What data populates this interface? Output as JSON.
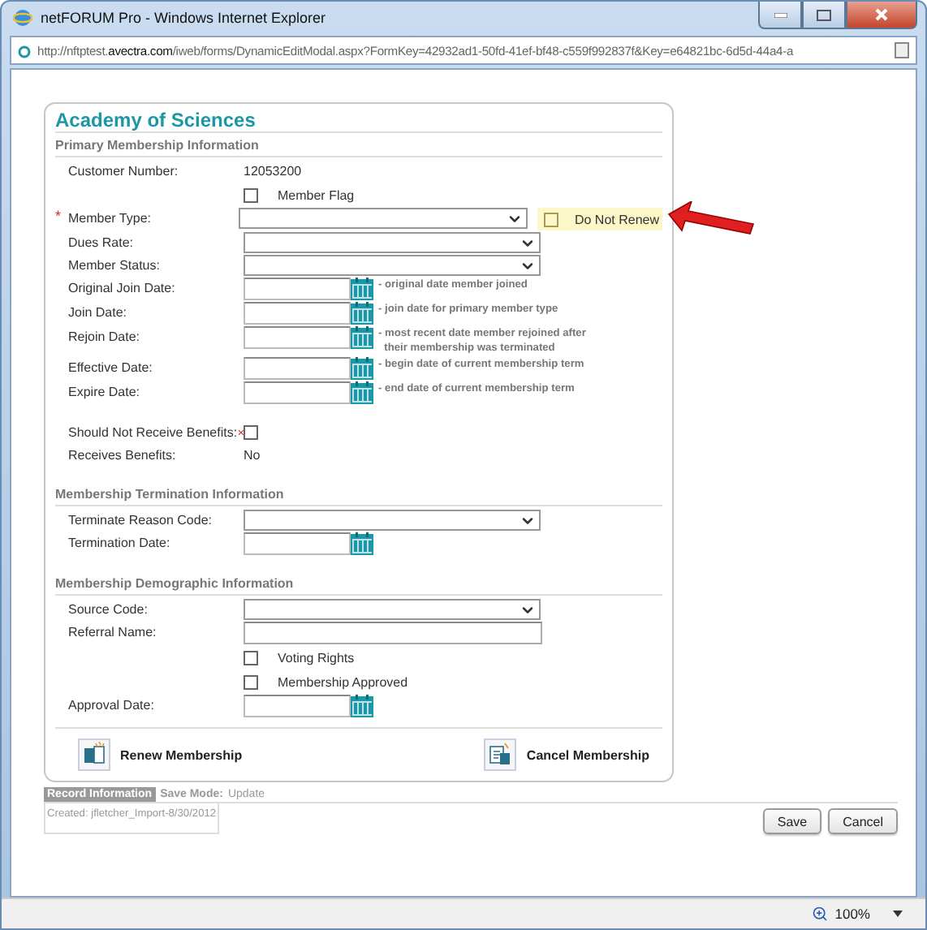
{
  "window": {
    "title": "netFORUM Pro - Windows Internet Explorer",
    "url": "http://nftptest.**avectra.com**/iweb/forms/DynamicEditModal.aspx?FormKey=42932ad1-50fd-41ef-bf48-c559f992837f&Key=e64821bc-6d5d-44a4-a"
  },
  "form": {
    "title": "Academy of Sciences",
    "sections": [
      {
        "heading": "Primary Membership Information",
        "rows": [
          {
            "kind": "text",
            "label": "Customer Number:",
            "value": "12053200"
          },
          {
            "kind": "checkbox",
            "label": "Member Flag",
            "checked": false
          },
          {
            "kind": "select",
            "label": "Member Type:",
            "required_mark": "*",
            "flag": {
              "label": "Do Not Renew",
              "checked": false
            }
          },
          {
            "kind": "select",
            "label": "Dues Rate:"
          },
          {
            "kind": "select",
            "label": "Member Status:"
          },
          {
            "kind": "date",
            "label": "Original Join Date:",
            "hint": "- original date member joined"
          },
          {
            "kind": "date",
            "label": "Join Date:",
            "hint": "- join date for primary member type"
          },
          {
            "kind": "date",
            "label": "Rejoin Date:",
            "hint": "- most recent date member rejoined after\n  their membership was terminated"
          },
          {
            "kind": "date",
            "label": "Effective Date:",
            "hint": "- begin date of current membership term"
          },
          {
            "kind": "date",
            "label": "Expire Date:",
            "hint": "- end date of current membership term"
          },
          {
            "kind": "labeled_checkbox",
            "label": "Should Not Receive Benefits:",
            "checked": false
          },
          {
            "kind": "text",
            "label": "Receives Benefits:",
            "value": "No"
          }
        ]
      },
      {
        "heading": "Membership Termination Information",
        "rows": [
          {
            "kind": "select",
            "label": "Terminate Reason Code:"
          },
          {
            "kind": "date",
            "label": "Termination Date:"
          }
        ]
      },
      {
        "heading": "Membership Demographic Information",
        "rows": [
          {
            "kind": "select",
            "label": "Source Code:"
          },
          {
            "kind": "input",
            "label": "Referral Name:"
          },
          {
            "kind": "checkbox",
            "label": "Voting Rights",
            "checked": false
          },
          {
            "kind": "checkbox",
            "label": "Membership Approved",
            "checked": false
          },
          {
            "kind": "date",
            "label": "Approval Date:"
          }
        ]
      }
    ],
    "actions": [
      {
        "kind": "renew",
        "label": "Renew Membership"
      },
      {
        "kind": "cancel",
        "label": "Cancel Membership"
      }
    ]
  },
  "record": {
    "tab": "Record Information",
    "save_mode_label": "Save Mode:",
    "save_mode": "Update",
    "created": "Created: jfletcher_Import-8/30/2012"
  },
  "buttons": [
    "Save",
    "Cancel"
  ],
  "status_bar": {
    "zoom": "100%"
  }
}
